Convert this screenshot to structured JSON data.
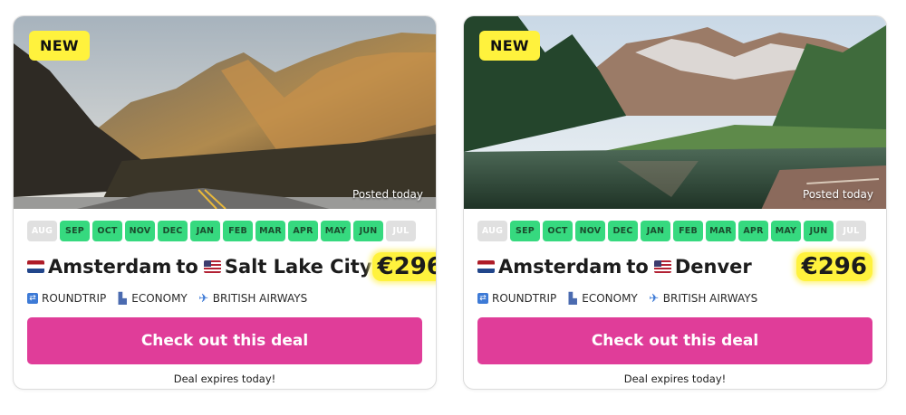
{
  "cards": [
    {
      "badge": "NEW",
      "posted": "Posted today",
      "scene": "mountain-valley-road",
      "months": [
        {
          "label": "AUG",
          "active": false
        },
        {
          "label": "SEP",
          "active": true
        },
        {
          "label": "OCT",
          "active": true
        },
        {
          "label": "NOV",
          "active": true
        },
        {
          "label": "DEC",
          "active": true
        },
        {
          "label": "JAN",
          "active": true
        },
        {
          "label": "FEB",
          "active": true
        },
        {
          "label": "MAR",
          "active": true
        },
        {
          "label": "APR",
          "active": true
        },
        {
          "label": "MAY",
          "active": true
        },
        {
          "label": "JUN",
          "active": true
        },
        {
          "label": "JUL",
          "active": false
        }
      ],
      "origin": "Amsterdam",
      "connector": "to",
      "destination": "Salt Lake City",
      "price": "€296",
      "trip_type": "ROUNDTRIP",
      "cabin": "ECONOMY",
      "airline": "BRITISH AIRWAYS",
      "cta": "Check out this deal",
      "expires": "Deal expires today!"
    },
    {
      "badge": "NEW",
      "posted": "Posted today",
      "scene": "alpine-lake-forest",
      "months": [
        {
          "label": "AUG",
          "active": false
        },
        {
          "label": "SEP",
          "active": true
        },
        {
          "label": "OCT",
          "active": true
        },
        {
          "label": "NOV",
          "active": true
        },
        {
          "label": "DEC",
          "active": true
        },
        {
          "label": "JAN",
          "active": true
        },
        {
          "label": "FEB",
          "active": true
        },
        {
          "label": "MAR",
          "active": true
        },
        {
          "label": "APR",
          "active": true
        },
        {
          "label": "MAY",
          "active": true
        },
        {
          "label": "JUN",
          "active": true
        },
        {
          "label": "JUL",
          "active": false
        }
      ],
      "origin": "Amsterdam",
      "connector": "to",
      "destination": "Denver",
      "price": "€296",
      "trip_type": "ROUNDTRIP",
      "cabin": "ECONOMY",
      "airline": "BRITISH AIRWAYS",
      "cta": "Check out this deal",
      "expires": "Deal expires today!"
    }
  ],
  "icons": {
    "origin_flag": "netherlands-flag-icon",
    "destination_flag": "usa-flag-icon",
    "trip_type": "roundtrip-icon",
    "cabin": "seat-icon",
    "airline": "airplane-icon"
  },
  "colors": {
    "badge": "#fff23d",
    "month_active": "#36d97f",
    "month_inactive": "#e0e0e0",
    "cta": "#e03d99",
    "price_highlight": "#fff23d"
  }
}
